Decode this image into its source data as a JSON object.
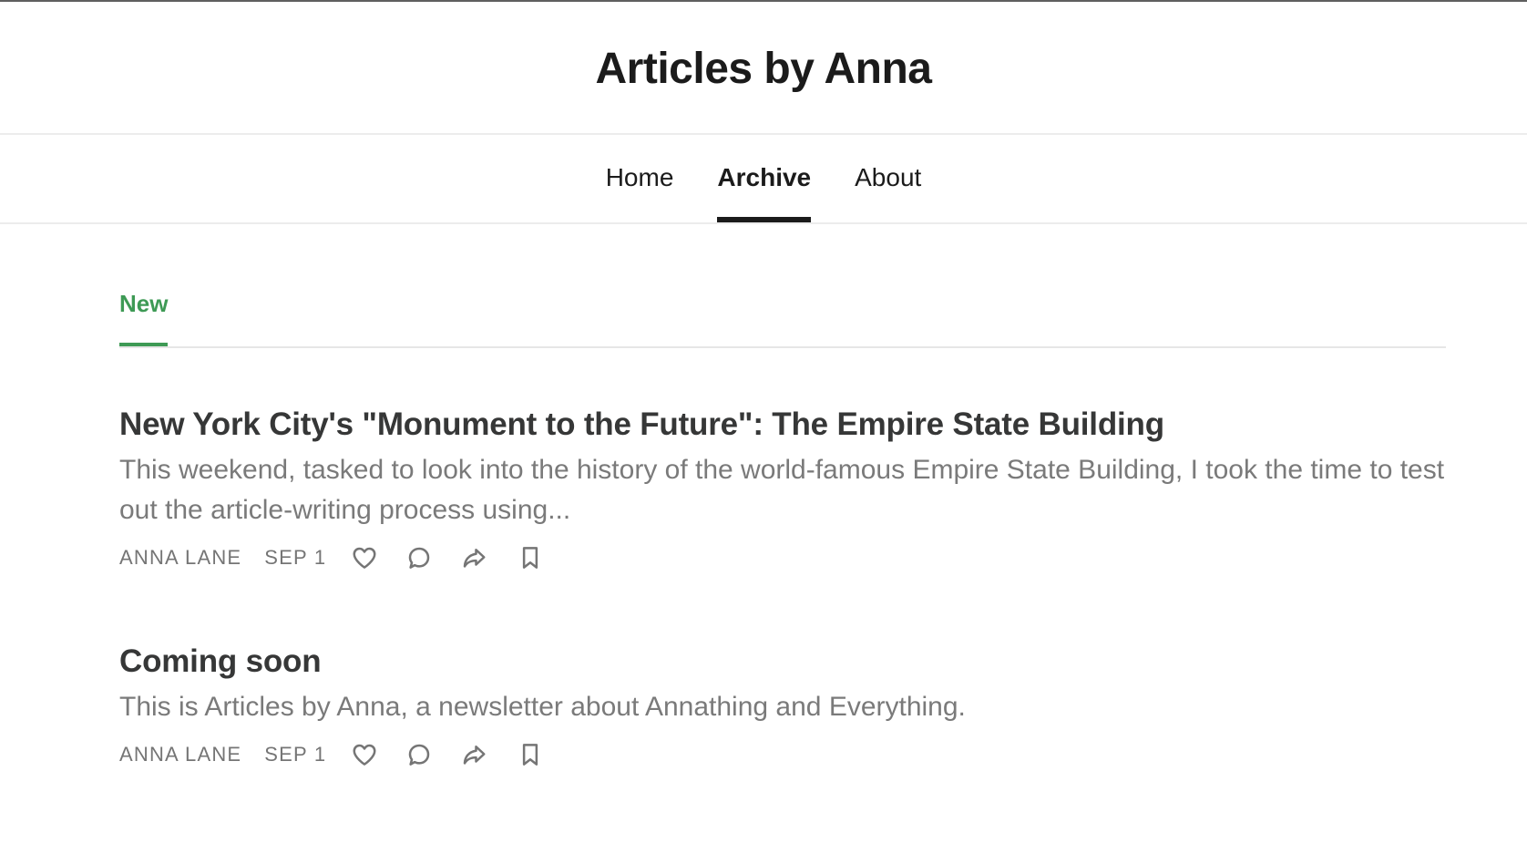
{
  "header": {
    "site_title": "Articles by Anna"
  },
  "nav": {
    "items": [
      {
        "label": "Home",
        "active": false
      },
      {
        "label": "Archive",
        "active": true
      },
      {
        "label": "About",
        "active": false
      }
    ]
  },
  "tabs": {
    "items": [
      {
        "label": "New",
        "active": true
      }
    ],
    "accent_color": "#3e9a55"
  },
  "posts": [
    {
      "title": "New York City's \"Monument to the Future\": The Empire State Building",
      "excerpt": "This weekend, tasked to look into the history of the world-famous Empire State Building, I took the time to test out the article-writing process using...",
      "author": "ANNA LANE",
      "date": "SEP 1",
      "actions": [
        "heart-icon",
        "comment-icon",
        "share-icon",
        "bookmark-icon"
      ]
    },
    {
      "title": "Coming soon",
      "excerpt": "This is Articles by Anna, a newsletter about Annathing and Everything.",
      "author": "ANNA LANE",
      "date": "SEP 1",
      "actions": [
        "heart-icon",
        "comment-icon",
        "share-icon",
        "bookmark-icon"
      ]
    }
  ]
}
